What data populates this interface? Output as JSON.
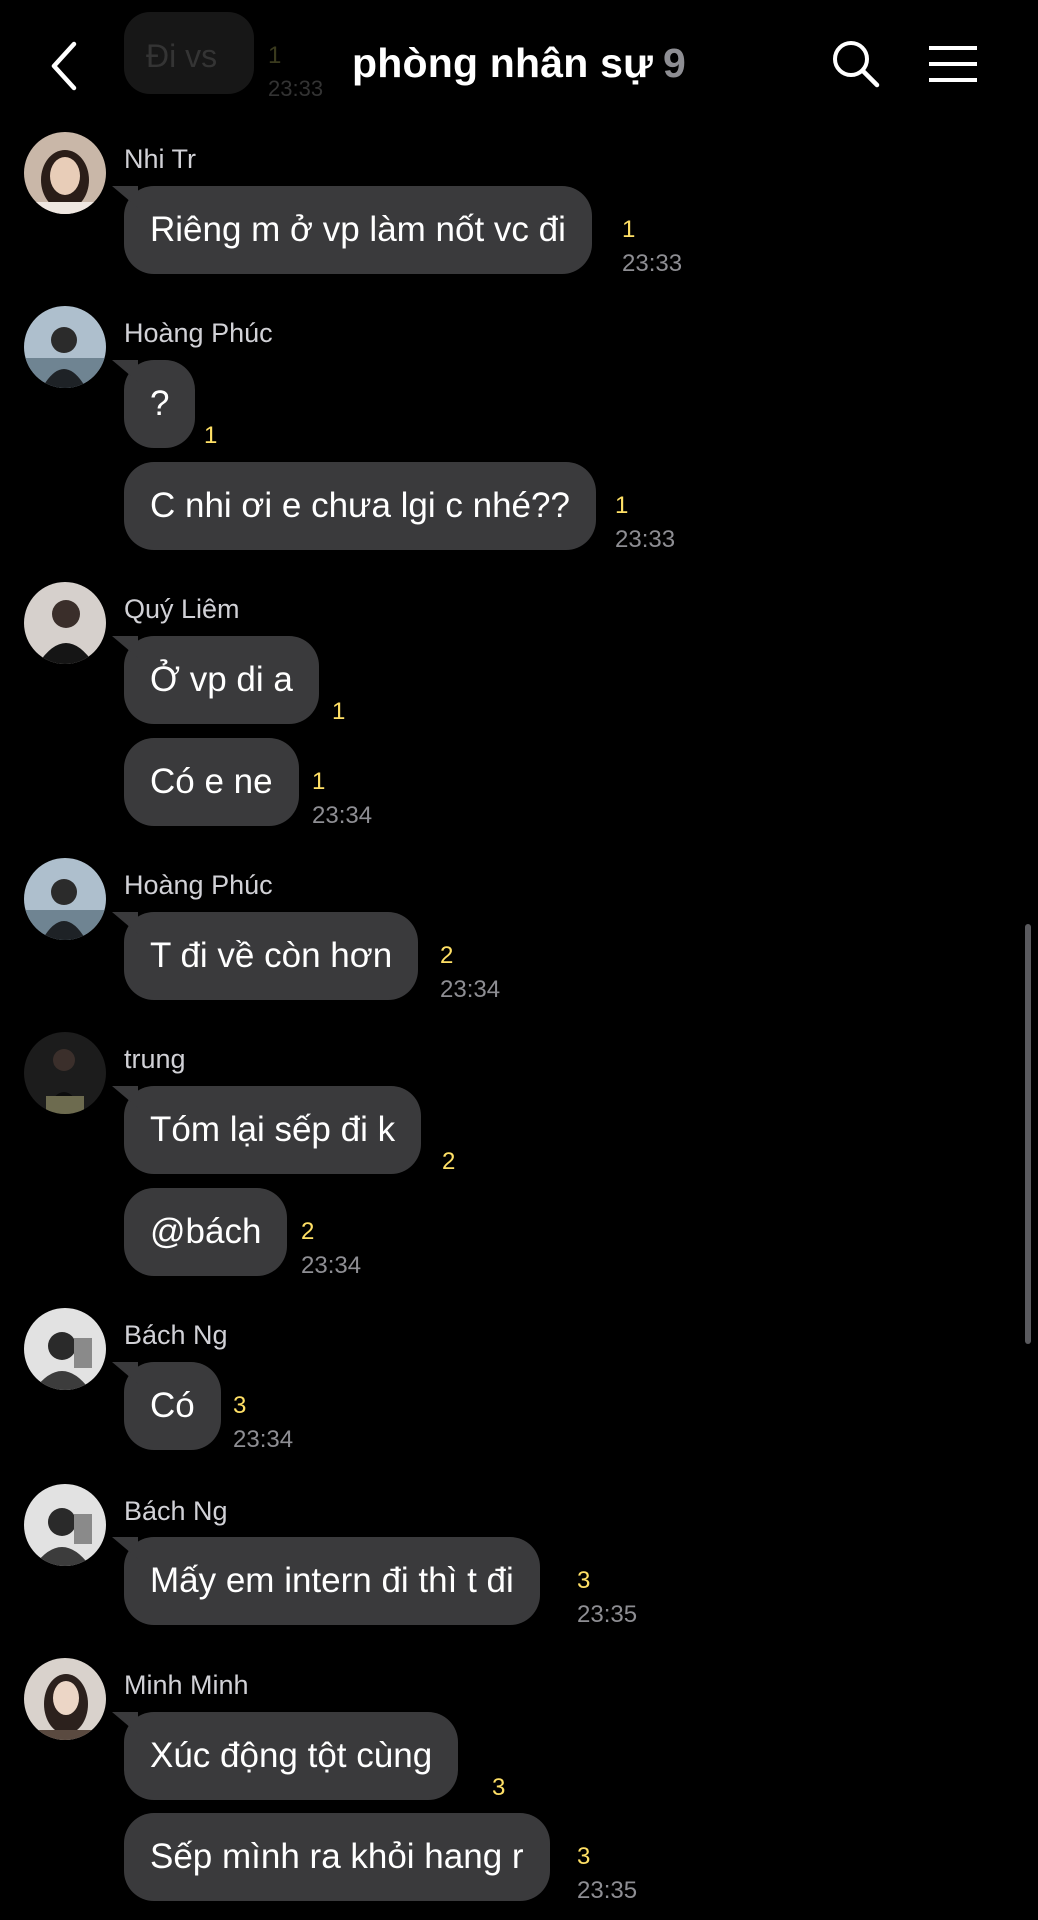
{
  "header": {
    "title": "phòng nhân sự",
    "member_count": "9"
  },
  "ghost_message": {
    "text": "Đi vs",
    "unread": "1",
    "time": "23:33"
  },
  "messages": [
    {
      "sender": "Nhi Tr",
      "text": "Riêng m ở vp làm nốt vc đi",
      "unread": "1",
      "time": "23:33"
    },
    {
      "sender": "Hoàng Phúc",
      "text": "?",
      "unread": "1"
    },
    {
      "text": "C nhi ơi e chưa lgi c nhé??",
      "unread": "1",
      "time": "23:33"
    },
    {
      "sender": "Quý Liêm",
      "text": "Ở vp di a",
      "unread": "1"
    },
    {
      "text": "Có e ne",
      "unread": "1",
      "time": "23:34"
    },
    {
      "sender": "Hoàng Phúc",
      "text": "T đi về còn hơn",
      "unread": "2",
      "time": "23:34"
    },
    {
      "sender": "trung",
      "text": "Tóm lại sếp đi k",
      "unread": "2"
    },
    {
      "text": "@bách",
      "unread": "2",
      "time": "23:34"
    },
    {
      "sender": "Bách Ng",
      "text": "Có",
      "unread": "3",
      "time": "23:34"
    },
    {
      "sender": "Bách Ng",
      "text": "Mấy em intern đi thì t đi",
      "unread": "3",
      "time": "23:35"
    },
    {
      "sender": "Minh Minh",
      "text": "Xúc động tột cùng",
      "unread": "3"
    },
    {
      "text": "Sếp mình ra khỏi hang r",
      "unread": "3",
      "time": "23:35"
    }
  ],
  "icons": {
    "back": "chevron-left-icon",
    "search": "search-icon",
    "menu": "hamburger-menu-icon"
  },
  "colors": {
    "background": "#000000",
    "bubble": "#3a3a3c",
    "unread_count": "#ffe066",
    "timestamp": "#8e8e93"
  }
}
